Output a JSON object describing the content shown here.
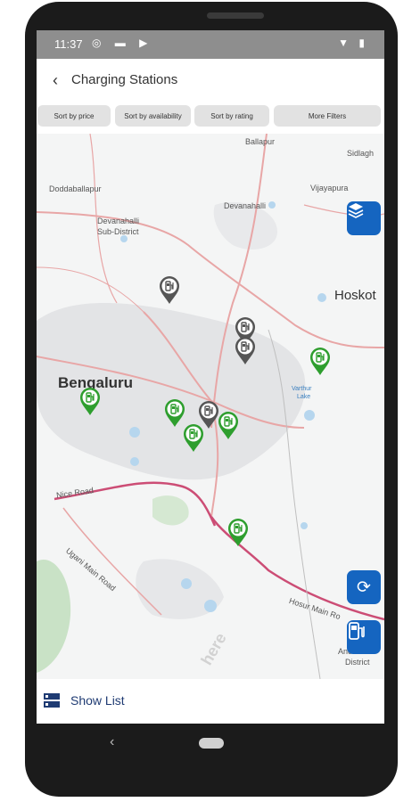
{
  "status_bar": {
    "time": "11:37",
    "left_icons": "◎ ▬ ▶",
    "right_icons": "▼ ▮"
  },
  "header": {
    "back_icon": "‹",
    "title": "Charging Stations"
  },
  "filters": [
    "Sort by price",
    "Sort by availability",
    "Sort by rating",
    "More Filters"
  ],
  "map": {
    "labels": {
      "ballapur": "Ballapur",
      "sidlagh": "Sidlagh",
      "doddaballapur": "Doddaballapur",
      "vijayapura": "Vijayapura",
      "devanahalli": "Devanahalli",
      "devanahalli_sub": "Devanahalli",
      "sub_district": "Sub-District",
      "hoskot": "Hoskot",
      "bengaluru": "Bengaluru",
      "varthur": "Varthur",
      "lake": "Lake",
      "nice_road": "Nice Road",
      "hosur_road": "Hosur Main Ro",
      "ugani_road": "Ugani Main Road",
      "anekal": "Ane",
      "district": "District",
      "watermark": "here"
    },
    "pin_colors": {
      "available": "#2e9e2e",
      "unavailable": "#555555"
    }
  },
  "fabs": {
    "layers_icon": "layers-icon",
    "refresh_icon": "refresh-icon",
    "charger_icon": "ev-charger-icon"
  },
  "bottom": {
    "show_list": "Show List"
  },
  "nav": {
    "back_icon": "‹"
  }
}
